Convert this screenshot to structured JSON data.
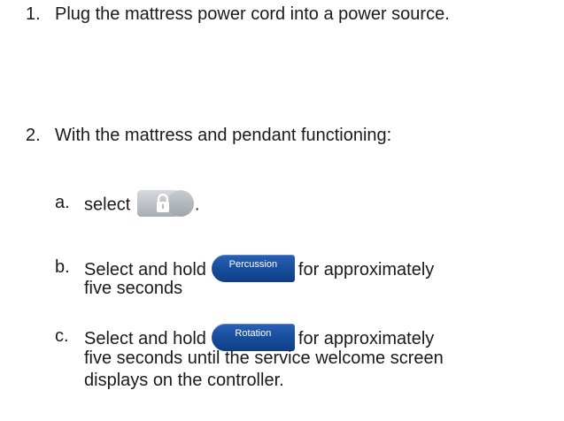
{
  "steps": [
    {
      "num": "1.",
      "text": "Plug the mattress power cord into a power source."
    },
    {
      "num": "2.",
      "text": "With the mattress and pendant functioning:"
    }
  ],
  "substeps": {
    "a": {
      "letter": "a.",
      "before": "select",
      "after": ".",
      "icon": "lock-icon"
    },
    "b": {
      "letter": "b.",
      "before": "Select and hold",
      "button": "Percussion",
      "after": "for approximately",
      "line2": "five seconds"
    },
    "c": {
      "letter": "c.",
      "before": "Select and hold",
      "button": "Rotation",
      "after": "for approximately",
      "line2": "five seconds until the service welcome screen",
      "line3": "displays on the controller."
    }
  }
}
